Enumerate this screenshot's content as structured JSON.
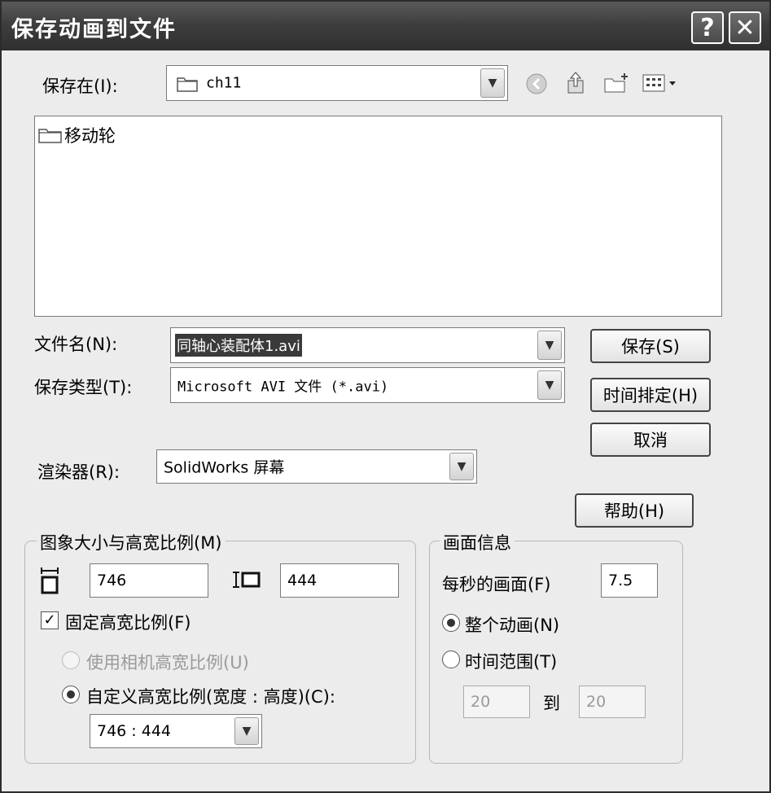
{
  "window": {
    "title": "保存动画到文件"
  },
  "titlebar": {
    "help_glyph": "?",
    "close_glyph": "✕"
  },
  "save_in": {
    "label": "保存在(I):",
    "value": "ch11",
    "toolbar_icons": [
      "back-icon",
      "up-folder-icon",
      "new-folder-icon",
      "view-menu-icon"
    ]
  },
  "file_list": {
    "items": [
      {
        "name": "移动轮",
        "icon": "folder-icon"
      }
    ]
  },
  "file_name": {
    "label": "文件名(N):",
    "value": "同轴心装配体1.avi"
  },
  "save_type": {
    "label": "保存类型(T):",
    "value": "Microsoft AVI 文件 (*.avi)"
  },
  "renderer": {
    "label": "渲染器(R):",
    "value": "SolidWorks 屏幕"
  },
  "buttons": {
    "save": "保存(S)",
    "schedule": "时间排定(H)",
    "cancel": "取消",
    "help": "帮助(H)"
  },
  "image_size": {
    "title": "图象大小与高宽比例(M)",
    "width": "746",
    "height": "444",
    "fixed_ratio_label": "固定高宽比例(F)",
    "fixed_ratio_checked": true,
    "camera_ratio_label": "使用相机高宽比例(U)",
    "custom_ratio_label": "自定义高宽比例(宽度 : 高度)(C):",
    "custom_ratio_value": "746 : 444"
  },
  "frame_info": {
    "title": "画面信息",
    "fps_label": "每秒的画面(F)",
    "fps_value": "7.5",
    "whole_label": "整个动画(N)",
    "range_label": "时间范围(T)",
    "range_from": "20",
    "range_to_label": "到",
    "range_to": "20"
  }
}
